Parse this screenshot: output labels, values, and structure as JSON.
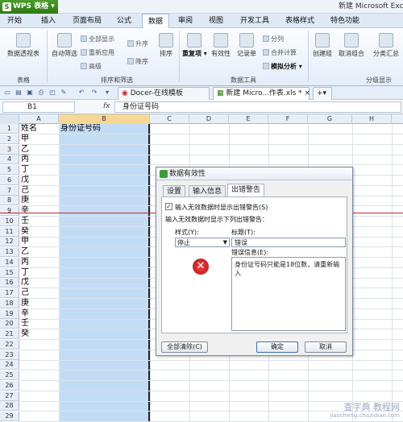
{
  "app": {
    "logo_text": "WPS 表格",
    "window_title": "新建 Microsoft Exce"
  },
  "menu": [
    "开始",
    "插入",
    "页面布局",
    "公式",
    "数据",
    "审阅",
    "视图",
    "开发工具",
    "表格样式",
    "特色功能"
  ],
  "ribbon": {
    "table_group": {
      "button": "数据透视表",
      "label": "表格"
    },
    "sort_filter": {
      "auto_filter": "自动筛选",
      "show_all": "全部显示",
      "reapply": "重新应用",
      "advanced": "高级",
      "asc": "升序",
      "desc": "降序",
      "sort": "排序",
      "label": "排序和筛选"
    },
    "data_tools": {
      "duplicates": "重复项",
      "validity": "有效性",
      "records": "记录单",
      "split": "分列",
      "consolidate": "合并计算",
      "whatif": "模拟分析",
      "label": "数据工具"
    },
    "outline": {
      "group": "创建组",
      "ungroup": "取消组合",
      "subtotal": "分类汇总",
      "label": "分级显示"
    }
  },
  "doc_tabs": [
    "Docer-在线模板",
    "新建 Micro...作表.xls *"
  ],
  "formula": {
    "cell_ref": "B1",
    "fx": "fx",
    "content": "身份证号码"
  },
  "columns": [
    "A",
    "B",
    "C",
    "D",
    "E",
    "F",
    "G",
    "H"
  ],
  "rows": [
    "1",
    "2",
    "3",
    "4",
    "5",
    "6",
    "7",
    "8",
    "9",
    "10",
    "11",
    "12",
    "13",
    "14",
    "15",
    "16",
    "17",
    "18",
    "19",
    "20",
    "21",
    "22",
    "23",
    "24",
    "25",
    "26",
    "27",
    "28",
    "29"
  ],
  "column_a": [
    "姓名",
    "甲",
    "乙",
    "丙",
    "丁",
    "戊",
    "己",
    "庚",
    "辛",
    "壬",
    "癸",
    "甲",
    "乙",
    "丙",
    "丁",
    "戊",
    "己",
    "庚",
    "辛",
    "壬",
    "癸"
  ],
  "b1": "身份证号码",
  "dialog": {
    "title": "数据有效性",
    "tabs": [
      "设置",
      "输入信息",
      "出错警告"
    ],
    "show_error_label": "输入无效数据时显示出错警告(S)",
    "section_label": "输入无效数据时显示下列出错警告：",
    "style_label": "样式(Y):",
    "style_value": "停止",
    "title_label": "标题(T):",
    "title_value": "错误",
    "message_label": "错误信息(E):",
    "message_value": "身份证号码只能是18位数，请重新输入",
    "clear_button": "全部清除(C)",
    "ok_button": "确定",
    "cancel_button": "取消"
  },
  "watermark": {
    "line1": "查字典 教程网",
    "line2": "jiaocheng.chazidian.com"
  }
}
